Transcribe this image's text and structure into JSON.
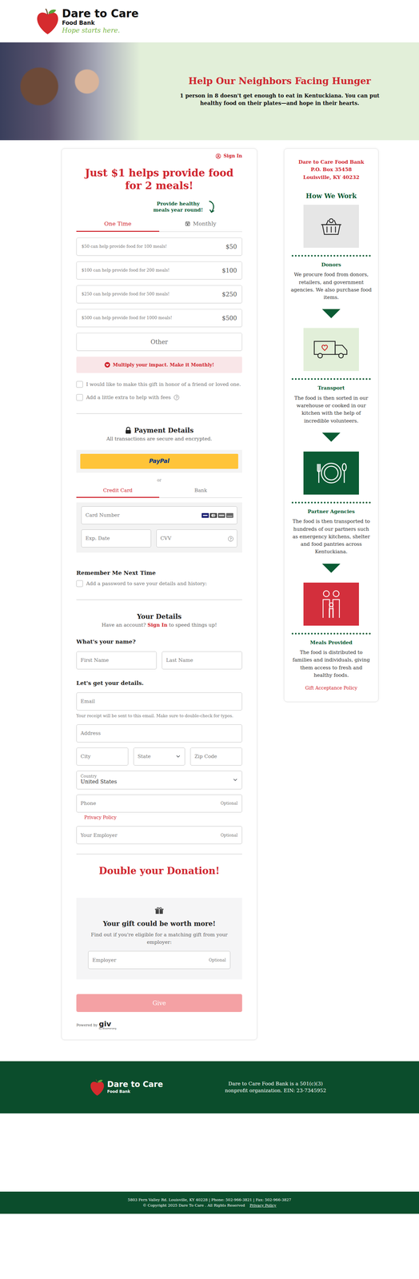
{
  "header": {
    "logo_name": "Dare to Care",
    "logo_sub": "Food Bank",
    "tagline": "Hope starts here."
  },
  "hero": {
    "title": "Help Our Neighbors Facing Hunger",
    "subtitle": "1 person in 8 doesn't get enough to eat in Kentuckiana. You can put healthy food on their plates—and hope in their hearts."
  },
  "form": {
    "sign_in": "Sign In",
    "headline": "Just $1 helps provide food for 2 meals!",
    "callout": "Provide healthy meals year round!",
    "frequency_tabs": [
      {
        "label": "One Time",
        "selected": true
      },
      {
        "label": "Monthly",
        "selected": false
      }
    ],
    "amounts": [
      {
        "text": "$50 can help provide food for 100 meals!",
        "amount": "$50",
        "selected": false
      },
      {
        "text": "$100 can help provide food for 200 meals!",
        "amount": "$100",
        "selected": false
      },
      {
        "text": "$250 can help provide food for 500 meals!",
        "amount": "$250",
        "selected": false
      },
      {
        "text": "$500 can help provide food for 1000 meals!",
        "amount": "$500",
        "selected": false
      }
    ],
    "other": "Other",
    "monthly_upsell": "Multiply your impact. Make it Monthly!",
    "options": [
      {
        "label": "I would like to make this gift in honor of a friend or loved one.",
        "checked": false
      },
      {
        "label": "Add a little extra to help with fees",
        "checked": false,
        "help": "?"
      }
    ],
    "payment": {
      "title": "Payment Details",
      "note": "All transactions are secure and encrypted.",
      "paypal": "PayPal",
      "or": "or",
      "tabs": [
        {
          "label": "Credit Card",
          "selected": true
        },
        {
          "label": "Bank",
          "selected": false
        }
      ],
      "card_number": "Card Number",
      "exp": "Exp. Date",
      "cvv": "CVV",
      "cvv_help": "?"
    },
    "remember": {
      "title": "Remember Me Next Time",
      "label": "Add a password to save your details and history:",
      "checked": false
    },
    "details": {
      "title": "Your Details",
      "account_prefix": "Have an account?",
      "account_link": "Sign In",
      "account_suffix": "to speed things up!",
      "name_q": "What's your name?",
      "first": "First Name",
      "last": "Last Name",
      "details_q": "Let's get your details.",
      "email": "Email",
      "email_help": "Your receipt will be sent to this email. Make sure to double-check for typos.",
      "address": "Address",
      "city": "City",
      "state": "State",
      "zip": "Zip Code",
      "country_label": "Country",
      "country": "United States",
      "phone": "Phone",
      "phone_optional": "Optional",
      "privacy": "Privacy Policy",
      "employer": "Your Employer",
      "employer_optional": "Optional"
    },
    "match": {
      "title": "Double your Donation!",
      "heading": "Your gift could be worth more!",
      "text": "Find out if you're eligible for a matching gift from your employer:",
      "employer": "Employer",
      "optional": "Optional"
    },
    "give": {
      "label": "Give",
      "disabled": true
    },
    "powered": {
      "prefix": "Powered by",
      "brand": "giv",
      "sub": "by Bloomerang"
    }
  },
  "sidebar": {
    "org": [
      "Dare to Care Food Bank",
      "P.O. Box 35458",
      "Louisville, KY 40232"
    ],
    "title": "How We Work",
    "steps": [
      {
        "title": "Donors",
        "text": "We procure food from donors, retailers, and government agencies. We also purchase food items.",
        "color": "#e6e6e6"
      },
      {
        "title": "Transport",
        "text": "The food is then sorted in our warehouse or cooked in our kitchen with the help of incredible volunteers.",
        "color": "#e2efd9"
      },
      {
        "title": "Partner Agencies",
        "text": "The food is then transported to hundreds of our partners such as emergency kitchens, shelter and food pantries across Kentuckiana.",
        "color": "#0b5b34"
      },
      {
        "title": "Meals Provided",
        "text": "The food is distributed to families and individuals, giving them access to fresh and healthy foods.",
        "color": "#d32f3c"
      }
    ],
    "policy": "Gift Acceptance Policy"
  },
  "footer": {
    "logo_name": "Dare to Care",
    "logo_sub": "Food Bank",
    "text": "Dare to Care Food Bank is a 501(c)(3) nonprofit organization. EIN: 23-7345952"
  },
  "bottom": {
    "address": "5803 Fern Valley Rd. Louisville, KY 40228 | Phone: 502-966-3821 | Fax: 502-966-3827",
    "copyright": "© Copyright 2025 Dare To Care . All Rights Reserved",
    "policy": "Privacy Policy"
  }
}
